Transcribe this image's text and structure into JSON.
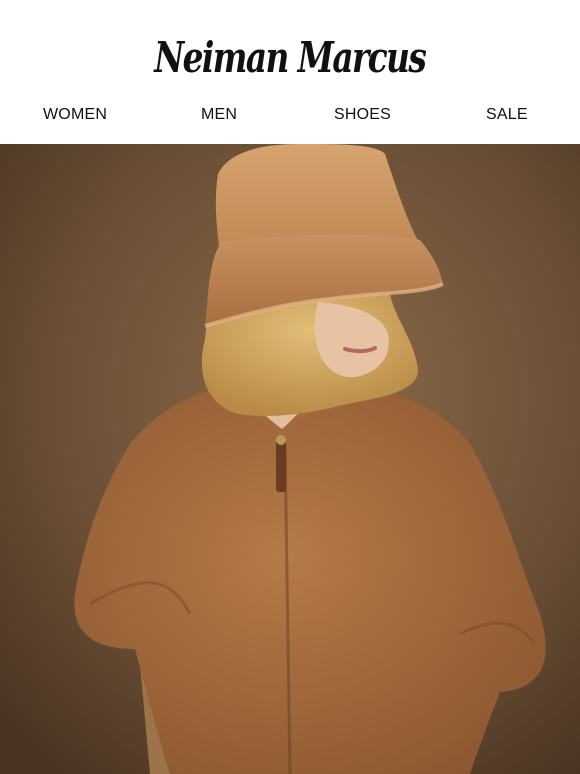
{
  "brand": {
    "logo_text": "Neiman Marcus"
  },
  "nav": {
    "items": [
      {
        "label": "WOMEN"
      },
      {
        "label": "MEN"
      },
      {
        "label": "SHOES"
      },
      {
        "label": "SALE"
      }
    ]
  },
  "hero": {
    "description_icon": "fashion-photo",
    "colors": {
      "background": "#6b4f35",
      "coat": "#a36a3e",
      "hat": "#c8925e",
      "hair": "#d6ad62",
      "skin": "#e7c3a4"
    }
  }
}
